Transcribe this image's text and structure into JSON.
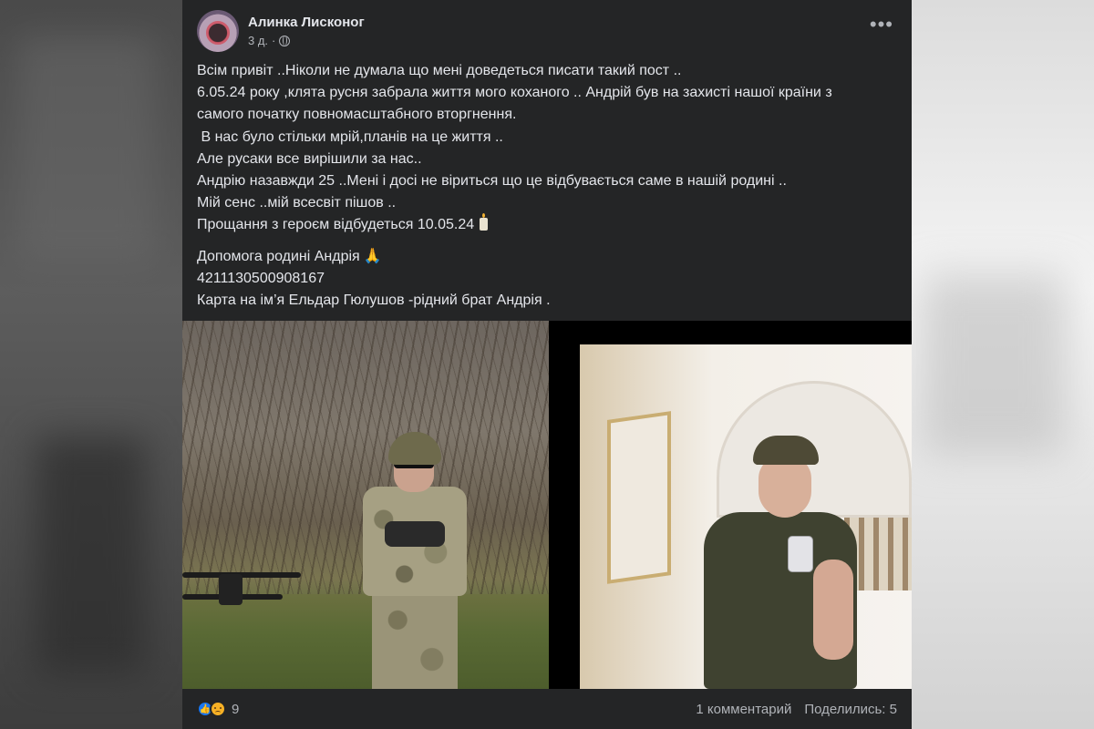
{
  "post": {
    "author": "Алинка Лисконог",
    "time": "3 д.",
    "more_label": "•••",
    "lines": [
      "Всім привіт ..Ніколи не думала що мені доведеться писати такий пост ..",
      "6.05.24 року ,клята русня забрала життя мого коханого .. Андрій був на захисті нашої країни з",
      "самого початку повномасштабного вторгнення.",
      " В нас було стільки мрій,планів на це життя ..",
      "Але русаки все вирішили за нас..",
      "Андрію назавжди 25 ..Мені і досі не віриться що це відбувається саме в нашій родині ..",
      "Мій сенс ..мій всесвіт пішов ..",
      "Прощання з героєм відбудеться 10.05.24"
    ],
    "help_lines": [
      "Допомога родині Андрія",
      "4211130500908167",
      "Карта на ім’я Ельдар Гюлушов -рідний брат Андрія ."
    ],
    "pray_emoji": "🙏"
  },
  "footer": {
    "reaction_count": "9",
    "comments": "1 комментарий",
    "shares": "Поделились: 5"
  },
  "icons": {
    "privacy": "globe-icon",
    "like": "like-reaction-icon",
    "sad": "sad-reaction-icon",
    "candle": "candle-icon"
  },
  "colors": {
    "card_bg": "#242526",
    "text": "#e4e6eb",
    "secondary": "#b0b3b8",
    "like_blue": "#1877f2"
  }
}
